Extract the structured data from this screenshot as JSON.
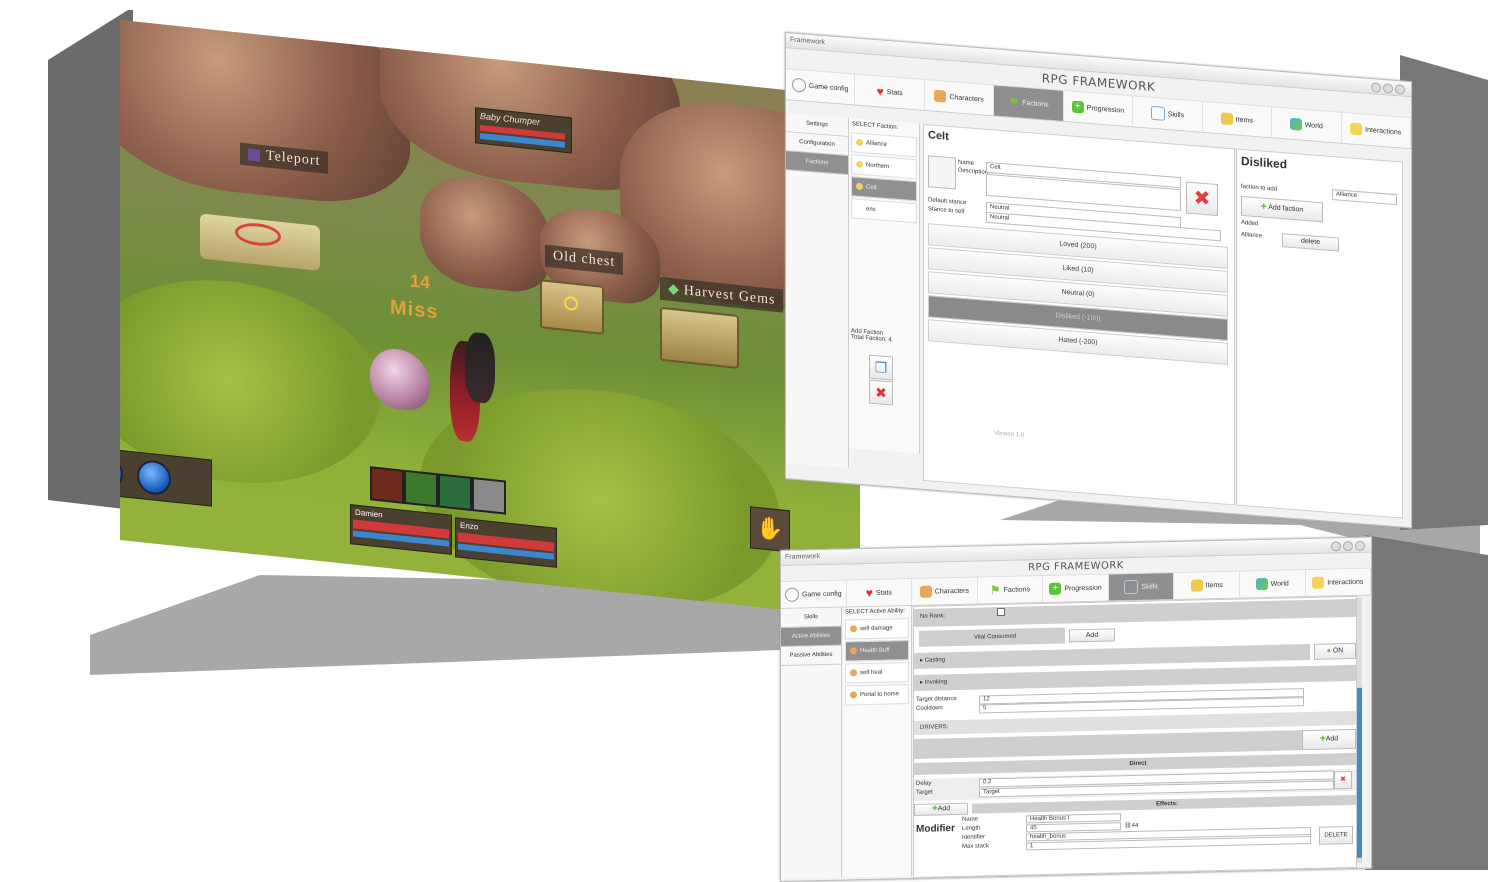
{
  "game": {
    "labels": {
      "teleport": "Teleport",
      "old_chest": "Old chest",
      "harvest_gems": "Harvest Gems",
      "enemy_name": "Baby Chumper"
    },
    "combat_text": {
      "damage": "14",
      "miss": "Miss"
    },
    "party": [
      {
        "name": "Damien"
      },
      {
        "name": "Enzo"
      }
    ],
    "colors": {
      "health": "#d03a3a",
      "mana": "#3a86d0",
      "combat_text": "#e2a23a"
    }
  },
  "window1": {
    "titlebar": "Framework",
    "title": "RPG FRAMEWORK",
    "tabs": [
      {
        "label": "Game config",
        "icon": "gear-icon"
      },
      {
        "label": "Stats",
        "icon": "heart-icon"
      },
      {
        "label": "Characters",
        "icon": "characters-icon"
      },
      {
        "label": "Factions",
        "icon": "flag-icon"
      },
      {
        "label": "Progression",
        "icon": "plus-icon"
      },
      {
        "label": "Skills",
        "icon": "skills-icon"
      },
      {
        "label": "Items",
        "icon": "items-icon"
      },
      {
        "label": "World",
        "icon": "world-icon"
      },
      {
        "label": "Interactions",
        "icon": "interactions-icon"
      }
    ],
    "sidebar": [
      {
        "label": "Settings"
      },
      {
        "label": "Configuration"
      },
      {
        "label": "Factions"
      }
    ],
    "select_label": "SELECT Faction:",
    "factions": [
      {
        "label": "Alliance"
      },
      {
        "label": "Northern"
      },
      {
        "label": "Celt"
      },
      {
        "label": "ens"
      }
    ],
    "add_faction": {
      "line1": "Add Faction",
      "line2": "Total Faction: 4"
    },
    "detail": {
      "name": "Celt",
      "name_label": "Name",
      "description_label": "Description",
      "name_value": "Celt",
      "default_stance_label": "Default stance",
      "stance_self_label": "Stance to self",
      "default_stance_value": "Neutral",
      "stance_self_value": "Neutral",
      "stances": [
        {
          "label": "Loved (200)"
        },
        {
          "label": "Liked (10)"
        },
        {
          "label": "Neutral (0)"
        },
        {
          "label": "Disliked (-100)"
        },
        {
          "label": "Hated (-200)"
        }
      ],
      "version": "Version 1.0"
    },
    "right": {
      "title": "Disliked",
      "faction_to_add_label": "faction to add",
      "faction_to_add_value": "Alliance",
      "add_button": "Add faction",
      "added_label": "Added",
      "added_item": "Alliance",
      "delete_button": "delete"
    }
  },
  "window2": {
    "titlebar": "Framework",
    "title": "RPG FRAMEWORK",
    "tabs": [
      {
        "label": "Game config"
      },
      {
        "label": "Stats"
      },
      {
        "label": "Characters"
      },
      {
        "label": "Factions"
      },
      {
        "label": "Progression"
      },
      {
        "label": "Skills"
      },
      {
        "label": "Items"
      },
      {
        "label": "World"
      },
      {
        "label": "Interactions"
      }
    ],
    "sidebar": [
      {
        "label": "Skills"
      },
      {
        "label": "Active Abilities"
      },
      {
        "label": "Passive Abilities"
      }
    ],
    "select_label": "SELECT Active Ability:",
    "abilities": [
      {
        "label": "self damage"
      },
      {
        "label": "Health Buff"
      },
      {
        "label": "self heal"
      },
      {
        "label": "Portal to home"
      }
    ],
    "form": {
      "no_rank": "No Rank:",
      "vital_consumed": "Vital Consumed",
      "add": "Add",
      "casting": "Casting",
      "on": "ON",
      "invoking": "Invoking",
      "target_distance_label": "Target distance",
      "target_distance_value": "12",
      "cooldown_label": "Cooldown",
      "cooldown_value": "5",
      "drivers": "DRIVERS:",
      "direct": "Direct",
      "delay_label": "Delay",
      "delay_value": "0.2",
      "target_label": "Target",
      "target_value": "Target",
      "effects": "Effects:",
      "modifier": "Modifier",
      "mod_name_label": "Name",
      "mod_name_value": "Health Bonus I",
      "mod_length_label": "Length",
      "mod_length_value": "45",
      "mod_id_label": "Identifier",
      "mod_id_value": "health_bonus",
      "mod_stack_label": "Max stack",
      "mod_stack_value": "1",
      "icon_id": "44",
      "delete": "DELETE"
    }
  }
}
